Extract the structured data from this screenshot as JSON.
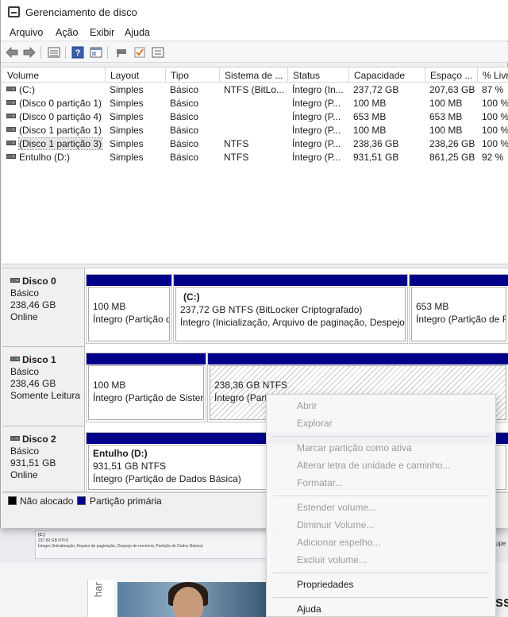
{
  "window": {
    "title": "Gerenciamento de disco"
  },
  "menu": [
    "Arquivo",
    "Ação",
    "Exibir",
    "Ajuda"
  ],
  "toolbar": [
    "back-arrow",
    "forward-arrow",
    "list-view",
    "help",
    "console",
    "connect",
    "checkmark",
    "properties"
  ],
  "volume_table": {
    "headers": [
      "Volume",
      "Layout",
      "Tipo",
      "Sistema de ...",
      "Status",
      "Capacidade",
      "Espaço ...",
      "% Livr"
    ],
    "rows": [
      [
        "(C:)",
        "Simples",
        "Básico",
        "NTFS (BitLo...",
        "Íntegro (In...",
        "237,72 GB",
        "207,63 GB",
        "87 %"
      ],
      [
        "(Disco 0 partição 1)",
        "Simples",
        "Básico",
        "",
        "Íntegro (P...",
        "100 MB",
        "100 MB",
        "100 %"
      ],
      [
        "(Disco 0 partição 4)",
        "Simples",
        "Básico",
        "",
        "Íntegro (P...",
        "653 MB",
        "653 MB",
        "100 %"
      ],
      [
        "(Disco 1 partição 1)",
        "Simples",
        "Básico",
        "",
        "Íntegro (P...",
        "100 MB",
        "100 MB",
        "100 %"
      ],
      [
        "(Disco 1 partição 3)",
        "Simples",
        "Básico",
        "NTFS",
        "Íntegro (P...",
        "238,36 GB",
        "238,26 GB",
        "100 %"
      ],
      [
        "Entulho (D:)",
        "Simples",
        "Básico",
        "NTFS",
        "Íntegro (P...",
        "931,51 GB",
        "861,25 GB",
        "92 %"
      ]
    ]
  },
  "disks": [
    {
      "name": "Disco 0",
      "type": "Básico",
      "size": "238,46 GB",
      "state": "Online",
      "partitions": [
        {
          "title": "",
          "line1": "100 MB",
          "line2": "Íntegro (Partição d"
        },
        {
          "title": "(C:)",
          "line1": "237,72 GB NTFS (BitLocker Criptografado)",
          "line2": "Íntegro (Inicialização, Arquivo de paginação, Despejo"
        },
        {
          "title": "",
          "line1": "653 MB",
          "line2": "Íntegro (Partição de Re"
        }
      ]
    },
    {
      "name": "Disco 1",
      "type": "Básico",
      "size": "238,46 GB",
      "state": "Somente Leitura",
      "partitions": [
        {
          "title": "",
          "line1": "100 MB",
          "line2": "Íntegro (Partição de Sister"
        },
        {
          "title": "",
          "line1": "238,36 GB NTFS",
          "line2": "Íntegro (Parti"
        }
      ]
    },
    {
      "name": "Disco 2",
      "type": "Básico",
      "size": "931,51 GB",
      "state": "Online",
      "partitions": [
        {
          "title": "Entulho  (D:)",
          "line1": "931,51 GB NTFS",
          "line2": "Íntegro (Partição de Dados Básica)"
        }
      ]
    }
  ],
  "legend": {
    "unallocated": "Não alocado",
    "primary": "Partição primária"
  },
  "context_menu": [
    {
      "label": "Abrir",
      "enabled": false
    },
    {
      "label": "Explorar",
      "enabled": false
    },
    {
      "label": "Marcar partição como ativa",
      "enabled": false
    },
    {
      "label": "Alterar letra de unidade e caminho...",
      "enabled": false
    },
    {
      "label": "Formatar...",
      "enabled": false
    },
    {
      "label": "Estender volume...",
      "enabled": false
    },
    {
      "label": "Diminuir Volume...",
      "enabled": false
    },
    {
      "label": "Adicionar espelho...",
      "enabled": false
    },
    {
      "label": "Excluir volume...",
      "enabled": false
    },
    {
      "label": "Propriedades",
      "enabled": true
    },
    {
      "label": "Ajuda",
      "enabled": true
    }
  ],
  "background": {
    "thumb_title": "(C:)",
    "thumb_line1": "237,82 GB NTFS",
    "thumb_line2": "Íntegro (Inicialização, Arquivo de paginação, Despejo de memória, Partição de Dados Básica)",
    "thumb_edge": "cupe",
    "side_text": "har",
    "edge_text": "ss"
  },
  "colors": {
    "primary_partition": "#00008a",
    "unallocated": "#000000"
  }
}
